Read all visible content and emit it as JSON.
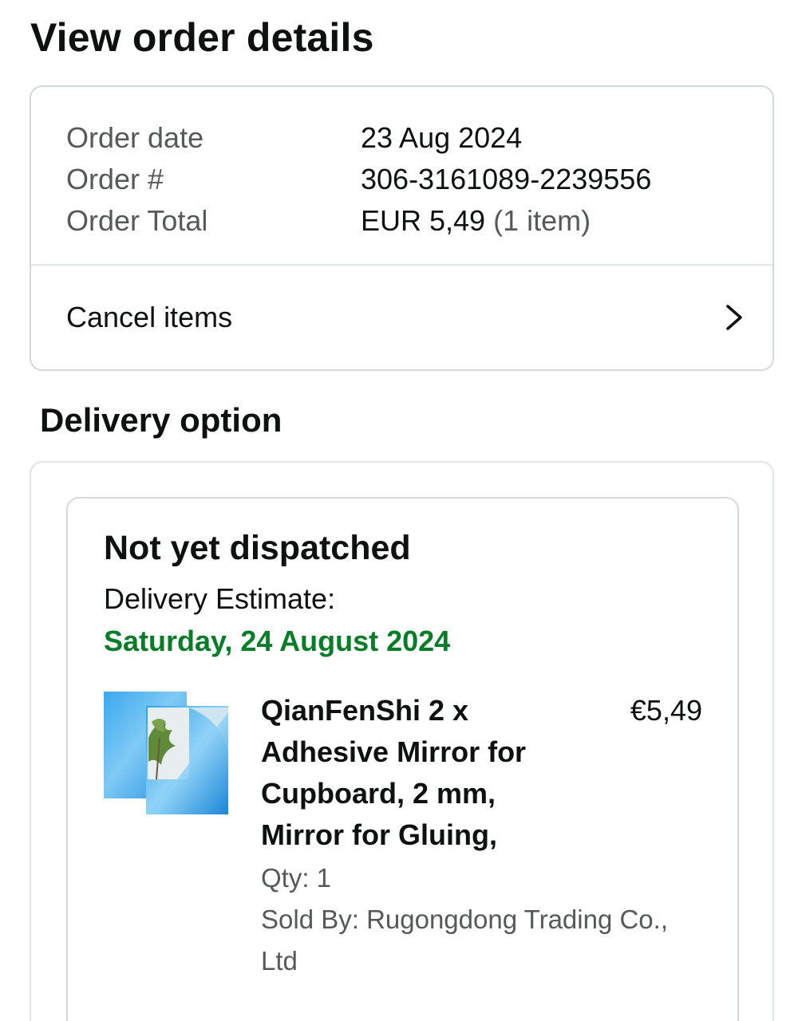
{
  "header": {
    "title": "View order details"
  },
  "summary": {
    "rows": [
      {
        "label": "Order date",
        "value": "23 Aug 2024"
      },
      {
        "label": "Order #",
        "value": "306-3161089-2239556"
      },
      {
        "label": "Order Total",
        "value": "EUR 5,49",
        "extra": "(1 item)"
      }
    ],
    "cancel_label": "Cancel items",
    "cancel_icon": "chevron-right-icon"
  },
  "delivery": {
    "section_title": "Delivery option",
    "status": "Not yet dispatched",
    "estimate_label": "Delivery Estimate:",
    "estimate_date": "Saturday, 24 August 2024",
    "estimate_color": "#067d26",
    "item": {
      "title": "QianFenShi 2 x Adhesive Mirror for Cupboard, 2 mm, Mirror for Gluing,",
      "price": "€5,49",
      "qty": "Qty: 1",
      "seller": "Sold By: Rugongdong Trading Co., Ltd",
      "image_icon": "mirror-product-image"
    }
  }
}
